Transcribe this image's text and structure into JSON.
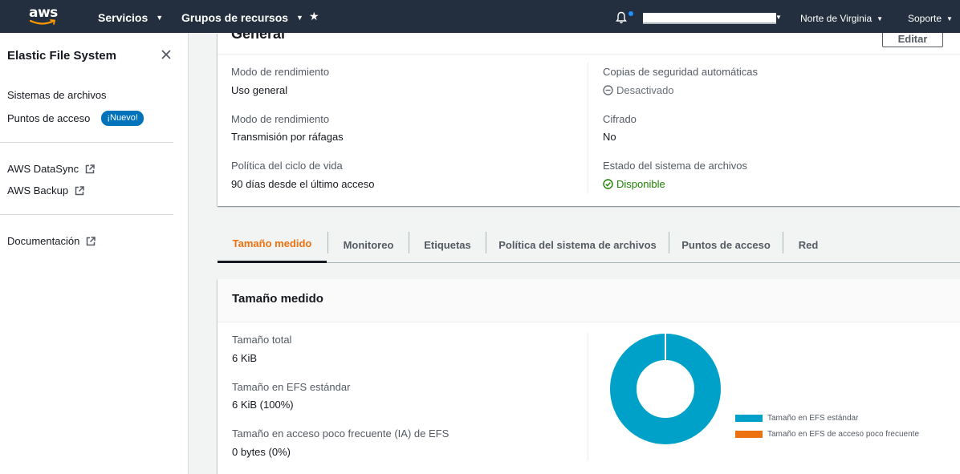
{
  "nav": {
    "brand": "aws",
    "services": "Servicios",
    "resource_groups": "Grupos de recursos",
    "region": "Norte de Virginia",
    "support": "Soporte"
  },
  "sidebar": {
    "title": "Elastic File System",
    "items": [
      {
        "label": "Sistemas de archivos"
      },
      {
        "label": "Puntos de acceso",
        "badge": "¡Nuevo!"
      }
    ],
    "external": [
      {
        "label": "AWS DataSync"
      },
      {
        "label": "AWS Backup"
      }
    ],
    "docs": "Documentación"
  },
  "general": {
    "title": "General",
    "edit": "Editar",
    "left": [
      {
        "label": "Modo de rendimiento",
        "value": "Uso general"
      },
      {
        "label": "Modo de rendimiento",
        "value": "Transmisión por ráfagas"
      },
      {
        "label": "Política del ciclo de vida",
        "value": "90 días desde el último acceso"
      }
    ],
    "right": [
      {
        "label": "Copias de seguridad automáticas",
        "value": "Desactivado"
      },
      {
        "label": "Cifrado",
        "value": "No"
      },
      {
        "label": "Estado del sistema de archivos",
        "value": "Disponible"
      }
    ]
  },
  "tabs": [
    {
      "label": "Tamaño medido",
      "active": true
    },
    {
      "label": "Monitoreo"
    },
    {
      "label": "Etiquetas"
    },
    {
      "label": "Política del sistema de archivos"
    },
    {
      "label": "Puntos de acceso"
    },
    {
      "label": "Red"
    }
  ],
  "metered": {
    "title": "Tamaño medido",
    "rows": [
      {
        "label": "Tamaño total",
        "value": "6 KiB"
      },
      {
        "label": "Tamaño en EFS estándar",
        "value": "6 KiB (100%)"
      },
      {
        "label": "Tamaño en acceso poco frecuente (IA) de EFS",
        "value": "0 bytes (0%)"
      }
    ]
  },
  "chart_data": {
    "type": "pie",
    "series": [
      {
        "name": "Tamaño en EFS estándar",
        "value": 100,
        "color": "#00a1c9"
      },
      {
        "name": "Tamaño en EFS de acceso poco frecuente",
        "value": 0,
        "color": "#ec7211"
      }
    ]
  }
}
